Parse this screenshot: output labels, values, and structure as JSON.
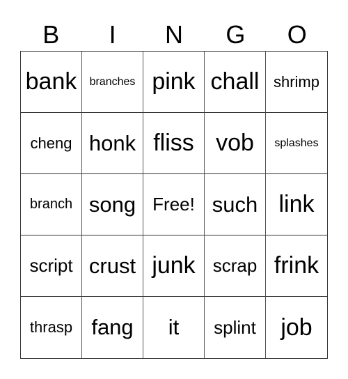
{
  "header": {
    "letters": [
      "B",
      "I",
      "N",
      "G",
      "O"
    ]
  },
  "grid": {
    "rows": [
      [
        "bank",
        "branches",
        "pink",
        "chall",
        "shrimp"
      ],
      [
        "cheng",
        "honk",
        "fliss",
        "vob",
        "splashes"
      ],
      [
        "branch",
        "song",
        "Free!",
        "such",
        "link"
      ],
      [
        "script",
        "crust",
        "junk",
        "scrap",
        "frink"
      ],
      [
        "thrasp",
        "fang",
        "it",
        "splint",
        "job"
      ]
    ]
  }
}
